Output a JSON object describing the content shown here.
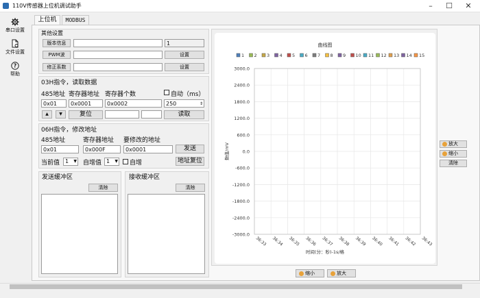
{
  "window": {
    "title": "110V传感器上位机调试助手",
    "buttons": [
      "–",
      "☐",
      "✕"
    ]
  },
  "sidebar": {
    "items": [
      {
        "label": "串口设置",
        "icon": "gear-icon"
      },
      {
        "label": "文件设置",
        "icon": "file-icon"
      },
      {
        "label": "帮助",
        "icon": "help-icon"
      }
    ]
  },
  "tabs": [
    {
      "label": "上位机",
      "active": true
    },
    {
      "label": "MODBUS",
      "active": false
    }
  ],
  "other_settings": {
    "title": "其他设置",
    "version_button": "版本信息",
    "version_value": "",
    "version_extra": "1",
    "pwm_button": "PWM波",
    "pwm_value": "",
    "pwm_set": "设置",
    "correction_button": "修正系数",
    "correction_value": "",
    "correction_set": "设置"
  },
  "cmd03": {
    "title": "03H指令，读取数据",
    "addr_label": "485地址",
    "reg_addr_label": "寄存器地址",
    "reg_count_label": "寄存器个数",
    "auto_label": "自动（ms）",
    "addr_value": "0x01",
    "reg_addr_value": "0x0001",
    "reg_count_value": "0x0002",
    "interval_value": "250",
    "up_label": "▲",
    "down_label": "▼",
    "reset_button": "复位",
    "read_button": "读取",
    "field1": "",
    "field2": ""
  },
  "cmd06": {
    "title": "06H指令，修改地址",
    "addr_label": "485地址",
    "reg_addr_label": "寄存器地址",
    "modify_addr_label": "要修改的地址",
    "addr_value": "0x01",
    "reg_addr_value": "0x000F",
    "modify_addr_value": "0x0001",
    "send_button": "发送",
    "current_label": "当前值",
    "current_value": "1",
    "increment_label": "自增值",
    "increment_value": "1",
    "auto_inc_label": "自增",
    "addr_reset_button": "地址复位"
  },
  "send_buffer": {
    "title": "发送缓冲区",
    "clear_button": "清除"
  },
  "receive_buffer": {
    "title": "接收缓冲区",
    "clear_button": "清除"
  },
  "side_buttons": {
    "zoom_in": "放大",
    "zoom_out": "缩小",
    "clear": "清除"
  },
  "bottom_buttons": {
    "zoom_out": "缩小",
    "zoom_in": "放大"
  },
  "chart_data": {
    "type": "line",
    "title": "曲线图",
    "xlabel": "时间(分：秒)-1s/格",
    "ylabel": "数值/mV",
    "ylim": [
      -3000,
      3000
    ],
    "yticks": [
      "3000.0",
      "2400.0",
      "1800.0",
      "1200.0",
      "600.0",
      "0.0",
      "-600.0",
      "-1200.0",
      "-1800.0",
      "-2400.0",
      "-3000.0"
    ],
    "xticks": [
      "36:33",
      "36:34",
      "36:35",
      "36:36",
      "36:37",
      "36:38",
      "36:39",
      "36:40",
      "36:41",
      "36:42",
      "36:43"
    ],
    "grid": true,
    "legend_position": "top",
    "series": [
      {
        "name": "1",
        "color": "#4f81bd",
        "values": []
      },
      {
        "name": "2",
        "color": "#9bbb59",
        "values": []
      },
      {
        "name": "3",
        "color": "#c7a94a",
        "values": []
      },
      {
        "name": "4",
        "color": "#8064a2",
        "values": []
      },
      {
        "name": "5",
        "color": "#c0504d",
        "values": []
      },
      {
        "name": "6",
        "color": "#4bacc6",
        "values": []
      },
      {
        "name": "7",
        "color": "#7f7f7f",
        "values": []
      },
      {
        "name": "8",
        "color": "#f6c142",
        "values": []
      },
      {
        "name": "9",
        "color": "#8064a2",
        "values": []
      },
      {
        "name": "10",
        "color": "#c0504d",
        "values": []
      },
      {
        "name": "11",
        "color": "#4bacc6",
        "values": []
      },
      {
        "name": "12",
        "color": "#9bbb59",
        "values": []
      },
      {
        "name": "13",
        "color": "#e0a050",
        "values": []
      },
      {
        "name": "14",
        "color": "#8064a2",
        "values": []
      },
      {
        "name": "15",
        "color": "#f79646",
        "values": []
      }
    ]
  }
}
